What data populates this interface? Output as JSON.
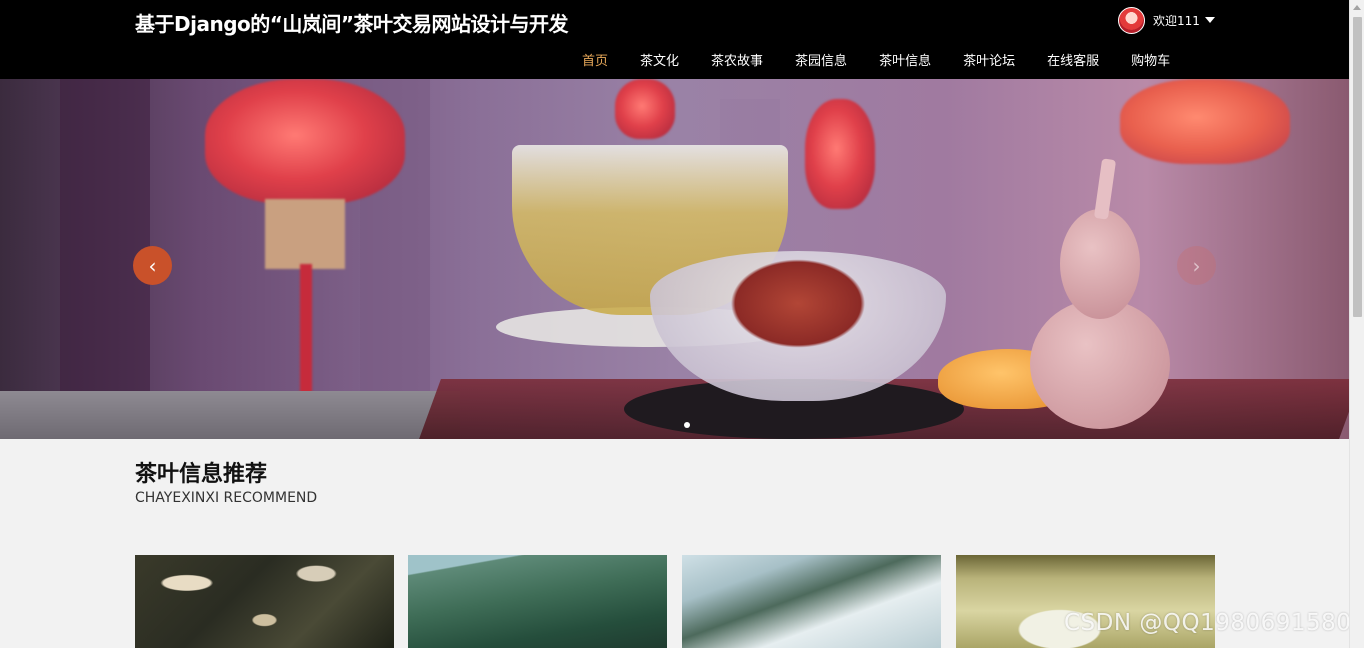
{
  "header": {
    "title": "基于Django的“山岚间”茶叶交易网站设计与开发",
    "welcome": "欢迎111",
    "nav": [
      {
        "label": "首页",
        "active": true
      },
      {
        "label": "茶文化",
        "active": false
      },
      {
        "label": "茶农故事",
        "active": false
      },
      {
        "label": "茶园信息",
        "active": false
      },
      {
        "label": "茶叶信息",
        "active": false
      },
      {
        "label": "茶叶论坛",
        "active": false
      },
      {
        "label": "在线客服",
        "active": false
      },
      {
        "label": "购物车",
        "active": false
      }
    ]
  },
  "banner": {
    "prev_icon": "chevron-left-icon",
    "next_icon": "chevron-right-icon",
    "prev_glyph": "‹",
    "next_glyph": "›"
  },
  "section": {
    "title": "茶叶信息推荐",
    "subtitle": "CHAYEXINXI RECOMMEND"
  },
  "watermark": "CSDN @QQ1980691580",
  "colors": {
    "header_bg": "#000000",
    "nav_active": "#e8a95a",
    "accent_arrow": "#c9512a",
    "page_bg": "#f2f2f2"
  }
}
